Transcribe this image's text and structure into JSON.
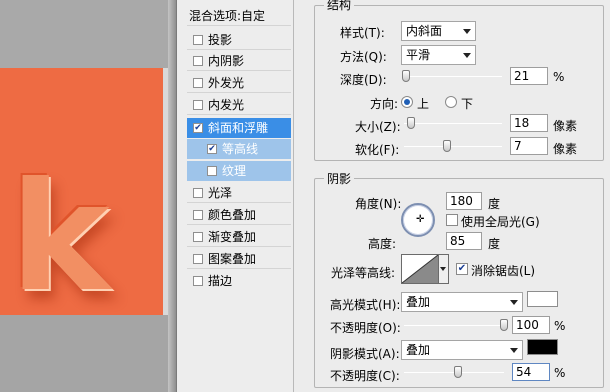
{
  "styles_panel": {
    "header": "混合选项:自定",
    "items": [
      {
        "label": "投影",
        "checked": false
      },
      {
        "label": "内阴影",
        "checked": false
      },
      {
        "label": "外发光",
        "checked": false
      },
      {
        "label": "内发光",
        "checked": false
      },
      {
        "label": "斜面和浮雕",
        "checked": true,
        "selected": true
      },
      {
        "label": "等高线",
        "checked": true,
        "sub": true
      },
      {
        "label": "纹理",
        "checked": false,
        "sub": true
      },
      {
        "label": "光泽",
        "checked": false
      },
      {
        "label": "颜色叠加",
        "checked": false
      },
      {
        "label": "渐变叠加",
        "checked": false
      },
      {
        "label": "图案叠加",
        "checked": false
      },
      {
        "label": "描边",
        "checked": false
      }
    ]
  },
  "structure": {
    "title": "结构",
    "style_label": "样式(T):",
    "style_value": "内斜面",
    "technique_label": "方法(Q):",
    "technique_value": "平滑",
    "depth_label": "深度(D):",
    "depth_value": "21",
    "depth_unit": "%",
    "depth_level": 0.02,
    "direction_label": "方向:",
    "direction_up": "上",
    "direction_down": "下",
    "direction_selected": "上",
    "size_label": "大小(Z):",
    "size_value": "18",
    "size_unit": "像素",
    "size_level": 0.07,
    "soften_label": "软化(F):",
    "soften_value": "7",
    "soften_unit": "像素",
    "soften_level": 0.44
  },
  "shading": {
    "title": "阴影",
    "angle_label": "角度(N):",
    "angle_value": "180",
    "angle_unit": "度",
    "global_light_label": "使用全局光(G)",
    "global_light_checked": false,
    "altitude_label": "高度:",
    "altitude_value": "85",
    "altitude_unit": "度",
    "gloss_contour_label": "光泽等高线:",
    "antialias_label": "消除锯齿(L)",
    "antialias_checked": true,
    "highlight_mode_label": "高光模式(H):",
    "highlight_mode_value": "叠加",
    "highlight_color": "#ffffff",
    "highlight_opacity_label": "不透明度(O):",
    "highlight_opacity_value": "100",
    "highlight_opacity_unit": "%",
    "highlight_opacity_level": 1.0,
    "shadow_mode_label": "阴影模式(A):",
    "shadow_mode_value": "叠加",
    "shadow_color": "#000000",
    "shadow_opacity_label": "不透明度(C):",
    "shadow_opacity_value": "54",
    "shadow_opacity_unit": "%",
    "shadow_opacity_level": 0.54
  },
  "canvas": {
    "glyph": "k",
    "background_color": "#ee6b43"
  }
}
